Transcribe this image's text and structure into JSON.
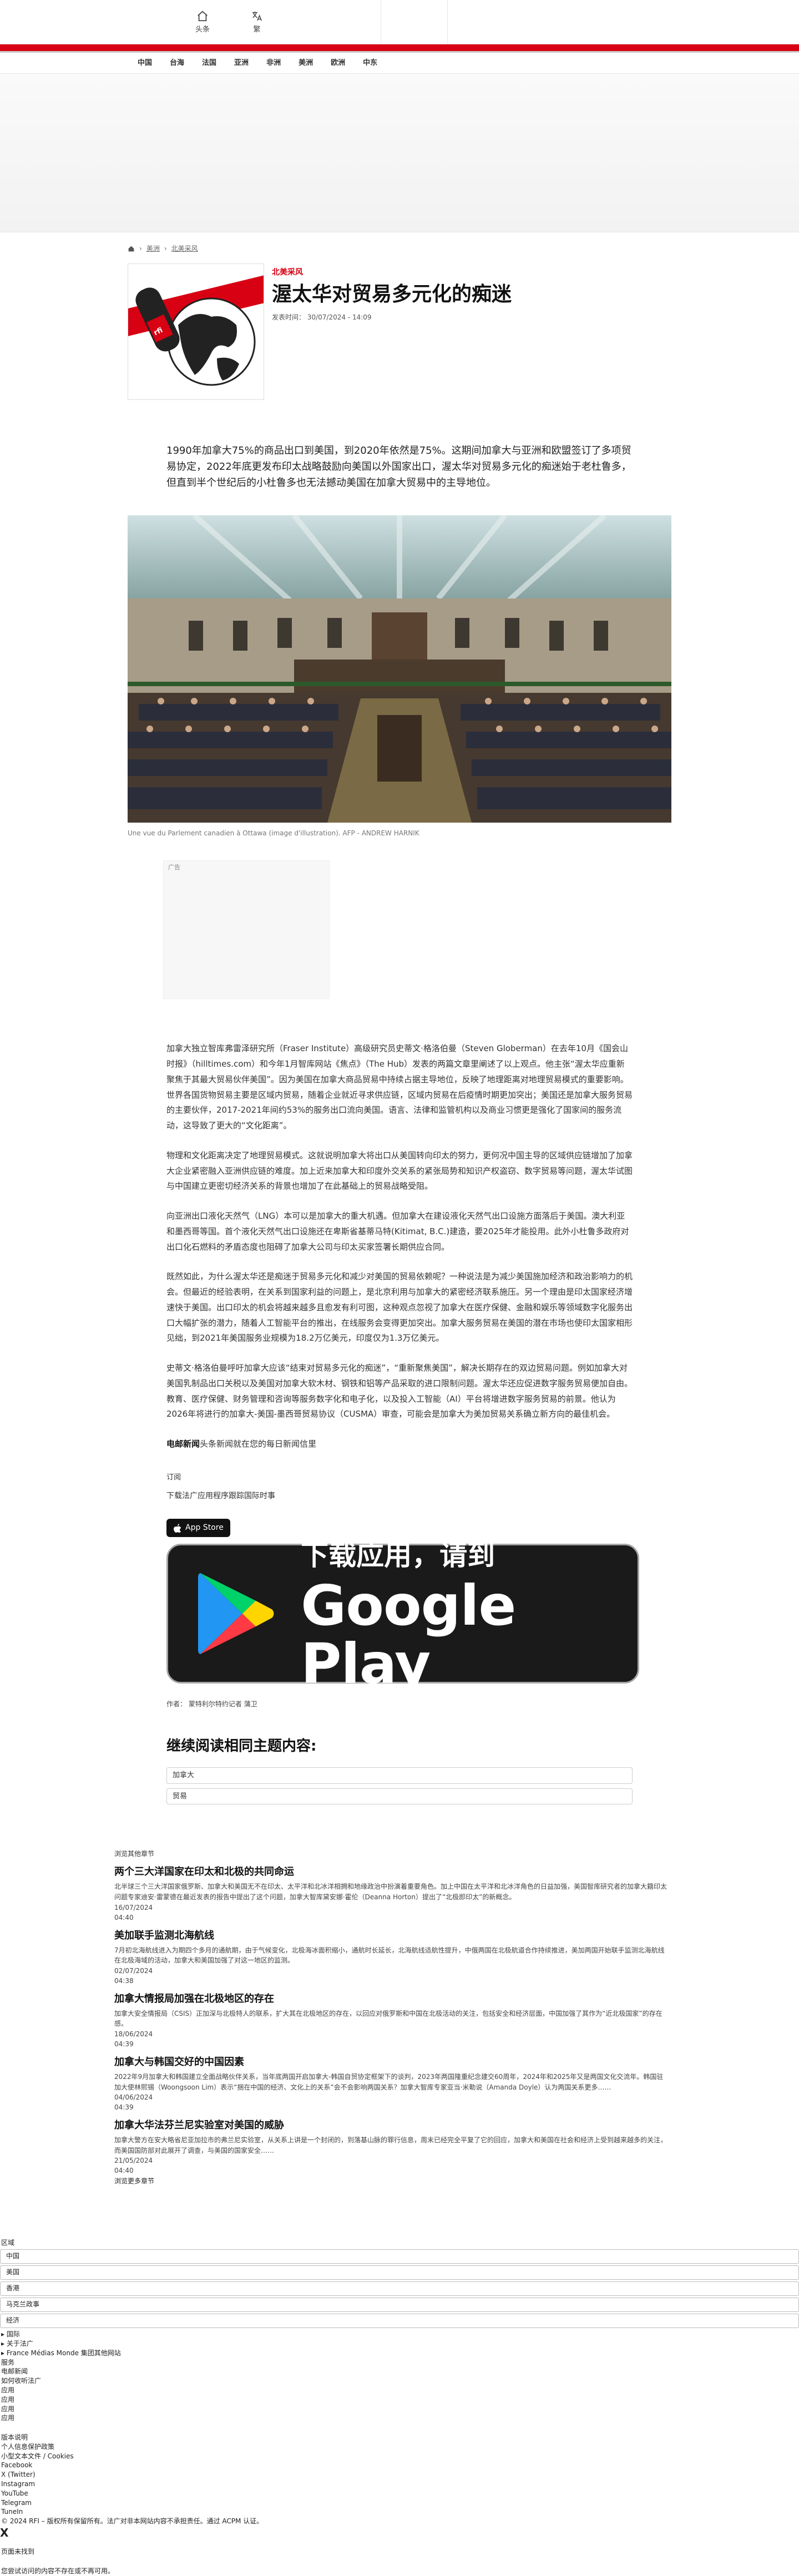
{
  "topbar": {
    "nav": [
      {
        "label": "头条",
        "icon": "house-icon"
      },
      {
        "label": "繁",
        "icon": "translate-icon"
      }
    ]
  },
  "subnav": [
    "中国",
    "台海",
    "法国",
    "亚洲",
    "非洲",
    "美洲",
    "欧洲",
    "中东"
  ],
  "breadcrumb": [
    "首页",
    "美洲",
    "北美采风"
  ],
  "article": {
    "kicker": "北美采风",
    "title": "渥太华对贸易多元化的痴迷",
    "published": "发表时间： 30/07/2024 - 14:09",
    "lead": "1990年加拿大75%的商品出口到美国，到2020年依然是75%。这期间加拿大与亚洲和欧盟签订了多项贸易协定，2022年底更发布印太战略鼓励向美国以外国家出口，渥太华对贸易多元化的痴迷始于老杜鲁多，但直到半个世纪后的小杜鲁多也无法撼动美国在加拿大贸易中的主导地位。",
    "photo_caption": "Une vue du Parlement canadien à Ottawa (image d'illustration). AFP - ANDREW HARNIK",
    "ad_label": "广告",
    "paragraphs": [
      "加拿大独立智库弗雷泽研究所（Fraser Institute）高级研究员史蒂文·格洛伯曼（Steven Globerman）在去年10月《国会山时报》（hilltimes.com）和今年1月智库网站《焦点》（The Hub）发表的两篇文章里阐述了以上观点。他主张“渥太华应重新聚焦于其最大贸易伙伴美国”。因为美国在加拿大商品贸易中持续占据主导地位，反映了地理距离对地理贸易模式的重要影响。世界各国货物贸易主要是区域内贸易，随着企业就近寻求供应链，区域内贸易在后疫情时期更加突出；美国还是加拿大服务贸易的主要伙伴，2017-2021年间约53%的服务出口流向美国。语言、法律和监管机构以及商业习惯更是强化了国家间的服务流动，这导致了更大的“文化距离”。",
      "物理和文化距离决定了地理贸易模式。这就说明加拿大将出口从美国转向印太的努力，更何况中国主导的区域供应链增加了加拿大企业紧密融入亚洲供应链的难度。加上近来加拿大和印度外交关系的紧张局势和知识产权盗窃、数字贸易等问题，渥太华试图与中国建立更密切经济关系的背景也增加了在此基础上的贸易战略受阻。",
      "向亚洲出口液化天然气（LNG）本可以是加拿大的重大机遇。但加拿大在建设液化天然气出口设施方面落后于美国。澳大利亚和墨西哥等国。首个液化天然气出口设施还在卑斯省基蒂马特(Kitimat, B.C.)建造，要2025年才能投用。此外小杜鲁多政府对出口化石燃料的矛盾态度也阻碍了加拿大公司与印太买家签署长期供应合同。",
      "既然如此，为什么渥太华还是痴迷于贸易多元化和减少对美国的贸易依赖呢？一种说法是为减少美国施加经济和政治影响力的机会。但最近的经验表明，在关系到国家利益的问题上，是北京利用与加拿大的紧密经济联系施压。另一个理由是印太国家经济增速快于美国。出口印太的机会将越来越多且愈发有利可图，这种观点忽视了加拿大在医疗保健、金融和娱乐等领域数字化服务出口大幅扩张的潜力，随着人工智能平台的推出，在线服务会变得更加突出。加拿大服务贸易在美国的潜在市场也使印太国家相形见绌，到2021年美国服务业规模为18.2万亿美元，印度仅为1.3万亿美元。",
      "史蒂文·格洛伯曼呼吁加拿大应该“结束对贸易多元化的痴迷”，“重新聚焦美国”，解决长期存在的双边贸易问题。例如加拿大对美国乳制品出口关税以及美国对加拿大软木材、钢铁和铝等产品采取的进口限制问题。渥太华还应促进数字服务贸易便加自由。教育、医疗保健、财务管理和咨询等服务数字化和电子化，以及投入工智能（AI）平台将增进数字服务贸易的前景。他认为2026年将进行的加拿大-美国-墨西哥贸易协议（CUSMA）审查，可能会是加拿大为美加贸易关系确立新方向的最佳机会。"
    ],
    "email_strong": "电邮新闻",
    "email_rest": "头条新闻就在您的每日新闻信里",
    "subscribe": "订阅",
    "download": "下载法广应用程序跟踪国际时事",
    "app_store": "App Store",
    "gplay_line1": "下载应用，请到",
    "gplay_line2": "Google Play",
    "author": "作者： 蒙特利尔特约记者 蒲卫",
    "related_heading": "继续阅读相同主题内容:",
    "tags": [
      "加拿大",
      "贸易"
    ]
  },
  "more": {
    "heading": "浏览其他章节",
    "items": [
      {
        "title": "两个三大洋国家在印太和北极的共同命运",
        "summary": "北半球三个三大洋国家俄罗斯、加拿大和美国无不在印太、太平洋和北冰洋相拥和地缘政治中扮演着重要角色。加上中国在太平洋和北冰洋角色的日益加强，美国智库研究者的加拿大籍印太问题专家迪安·雷蒙德在最近发表的报告中提出了这个问题，加拿大智库黛安娜·霍伦（Deanna Horton）提出了“北极即印太”的新概念。",
        "date": "16/07/2024",
        "time": "04:40"
      },
      {
        "title": "美加联手监测北海航线",
        "summary": "7月初北海航线进入为期四个多月的通航期，由于气候变化，北极海冰面积缩小，通航时长延长，北海航线适航性提升，中俄两国在北极航道合作持续推进，美加两国开始联手监测北海航线在北极海域的活动，加拿大和美国加强了对这一地区的监测。",
        "date": "02/07/2024",
        "time": "04:38"
      },
      {
        "title": "加拿大情报局加强在北极地区的存在",
        "summary": "加拿大安全情报局（CSIS）正加深与北极特人的联系，扩大其在北极地区的存在，以回应对俄罗斯和中国在北极活动的关注，包括安全和经济层面，中国加强了其作为“近北极国家”的存在感。",
        "date": "18/06/2024",
        "time": "04:39"
      },
      {
        "title": "加拿大与韩国交好的中国因素",
        "summary": "2022年9月加拿大和韩国建立全面战略伙伴关系，当年底两国开启加拿大-韩国自贸协定框架下的谈判，2023年两国隆重纪念建交60周年，2024年和2025年又是两国文化交流年。韩国驻加大使林熙锡（Woongsoon Lim）表示“捆在中国的经济、文化上的关系”会不会影响两国关系？加拿大智库专家亚当·米勒说（Amanda Doyle）认为两国关系更多……",
        "date": "04/06/2024",
        "time": "04:39"
      },
      {
        "title": "加拿大华法芬兰尼实验室对美国的威胁",
        "summary": "加拿大警方在安大略省尼亚加拉市的弗兰尼实验室，从关系上讲是一个封闭的，到落基山脉的罪行信息，周末已经完全平复了它的回应，加拿大和美国在社会和经济上受到越来越多的关注，而美国国防部对此展开了调查，与美国的国家安全……",
        "date": "21/05/2024",
        "time": "04:40"
      }
    ],
    "all": "浏览更多章节"
  },
  "footer": {
    "region_label": "区域",
    "regions": [
      "中国",
      "美国",
      "香港",
      "马克兰政事",
      "经济"
    ],
    "lines": [
      "▸ 国际",
      "▸ 关于法广",
      "▸ France Médias Monde 集团其他网站",
      "服务",
      "电邮新闻",
      "如何收听法广",
      "应用",
      "应用",
      "应用",
      "应用"
    ],
    "legal_lines": [
      "版本说明",
      "个人信息保护政策",
      "小型文本文件 / Cookies",
      "Facebook",
      "X (Twitter)",
      "Instagram",
      "YouTube",
      "Telegram",
      "TuneIn",
      "© 2024 RFI – 版权所有保留所有。法广对非本网站内容不承担责任。通过 ACPM 认证。"
    ],
    "close": "X",
    "notfound": "页面未找到",
    "notfound_msg": "您尝试访问的内容不存在或不再可用。"
  }
}
